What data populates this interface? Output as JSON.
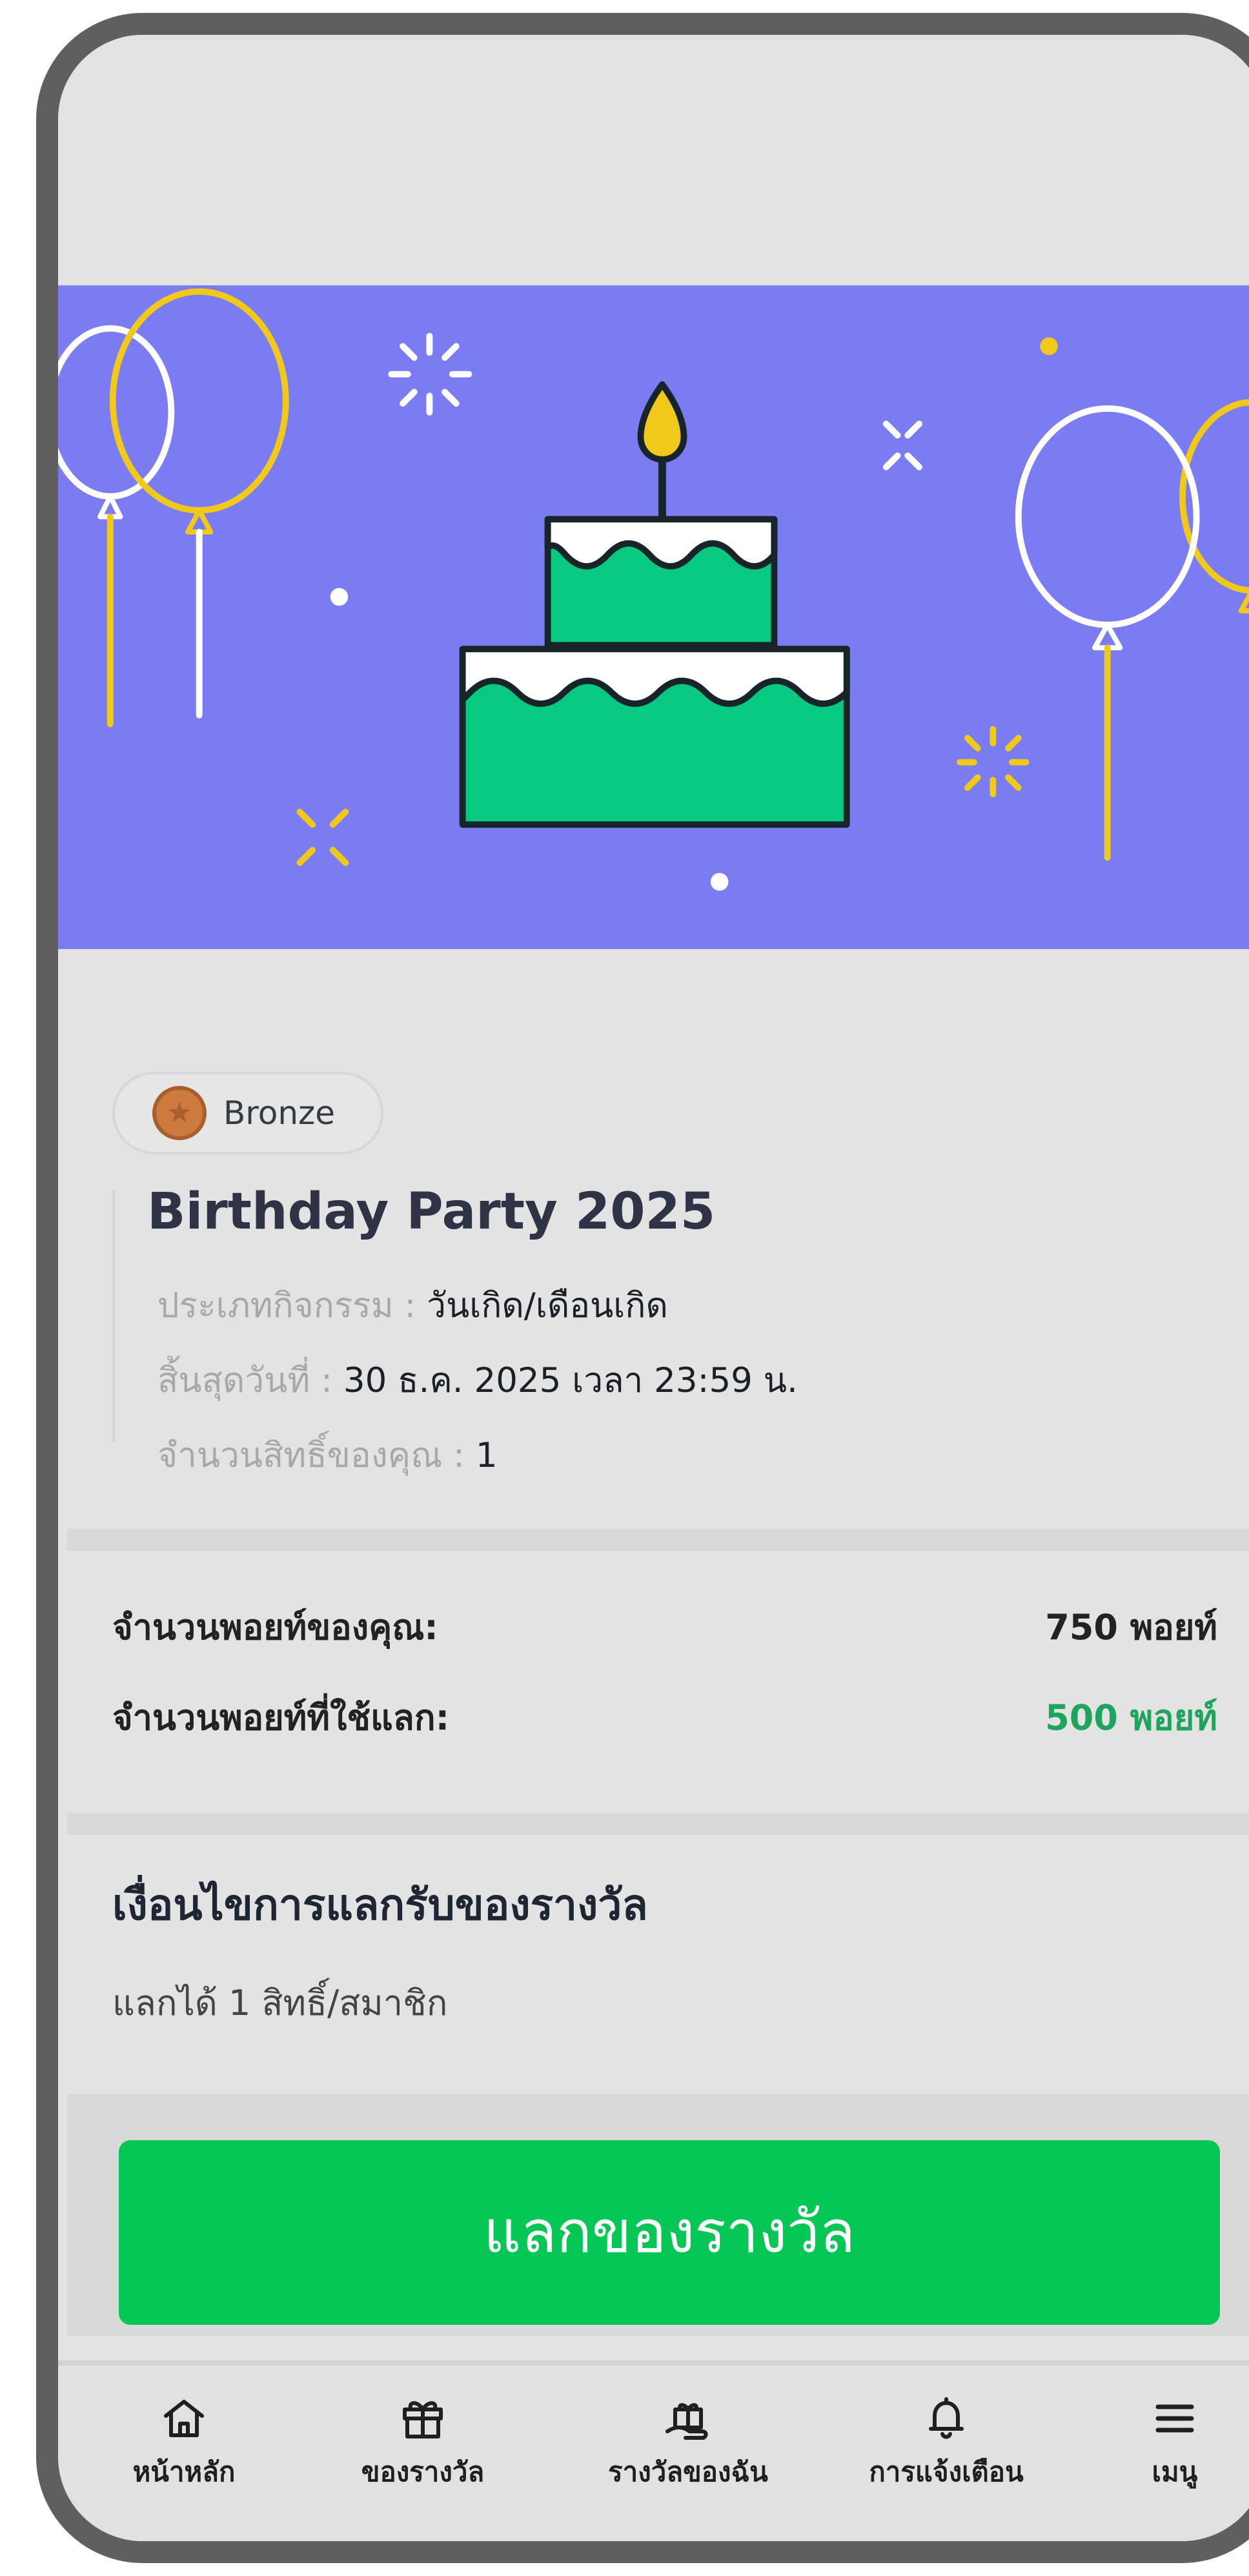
{
  "activity": {
    "tier": "Bronze",
    "title": "Birthday Party 2025",
    "type_label": "ประเภทกิจกรรม :",
    "type_value": "วันเกิด/เดือนเกิด",
    "expiry_label": "สิ้นสุดวันที่ :",
    "expiry_value": "30 ธ.ค. 2025 เวลา 23:59 น.",
    "rights_label": "จำนวนสิทธิ์ของคุณ :",
    "rights_value": "1"
  },
  "points": {
    "your_points_label": "จำนวนพอยท์ของคุณ:",
    "your_points_value": "750 พอยท์",
    "redeem_cost_label": "จำนวนพอยท์ที่ใช้แลก:",
    "redeem_cost_value": "500 พอยท์"
  },
  "conditions": {
    "title": "เงื่อนไขการแลกรับของรางวัล",
    "text": "แลกได้ 1 สิทธิ์/สมาชิก"
  },
  "actions": {
    "redeem_button_label": "แลกของรางวัล"
  },
  "bottom_nav": {
    "items": [
      {
        "label": "หน้าหลัก",
        "icon": "home-icon"
      },
      {
        "label": "ของรางวัล",
        "icon": "gift-icon"
      },
      {
        "label": "รางวัลของฉัน",
        "icon": "my-rewards-icon"
      },
      {
        "label": "การแจ้งเตือน",
        "icon": "bell-icon"
      },
      {
        "label": "เมนู",
        "icon": "menu-icon"
      }
    ]
  },
  "colors": {
    "banner_bg": "#7b7cf2",
    "accent_green": "#06c755",
    "points_green": "#1ea55c",
    "frame": "#5f5f5f"
  }
}
